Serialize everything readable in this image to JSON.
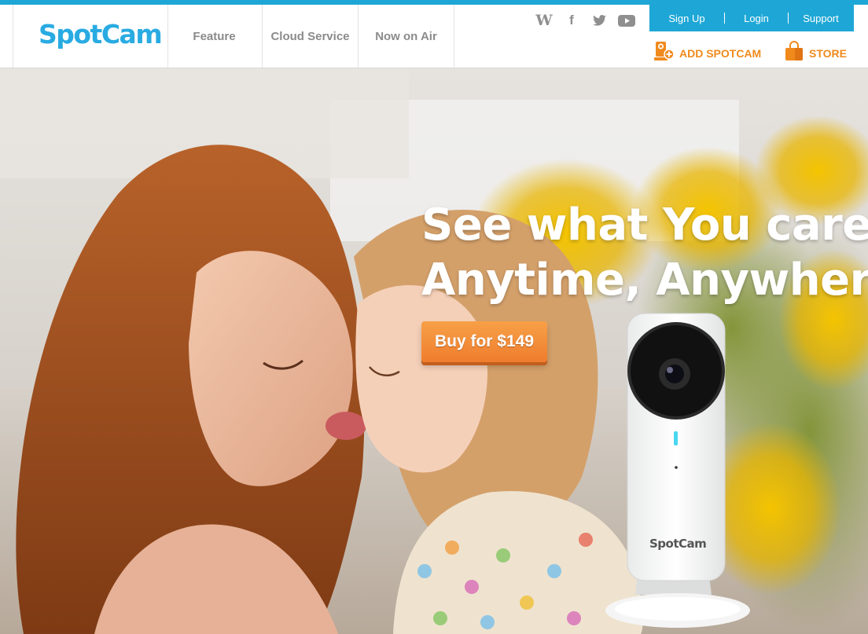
{
  "brand": {
    "logo_text": "SpotCam",
    "accent": "#1ea7d6",
    "orange": "#f08a1c"
  },
  "nav": {
    "items": [
      {
        "label": "Feature"
      },
      {
        "label": "Cloud Service"
      },
      {
        "label": "Now on Air"
      }
    ]
  },
  "social": {
    "icons": [
      "wikipedia-icon",
      "facebook-icon",
      "twitter-icon",
      "youtube-icon"
    ]
  },
  "account": {
    "signup": "Sign Up",
    "login": "Login",
    "support": "Support"
  },
  "actions": {
    "add_spotcam": "ADD SPOTCAM",
    "store": "STORE"
  },
  "hero": {
    "headline_line1": "See what You care",
    "headline_line2": "Anytime, Anywhere.",
    "buy_button": "Buy for $149",
    "camera_brand": "SpotCam"
  }
}
